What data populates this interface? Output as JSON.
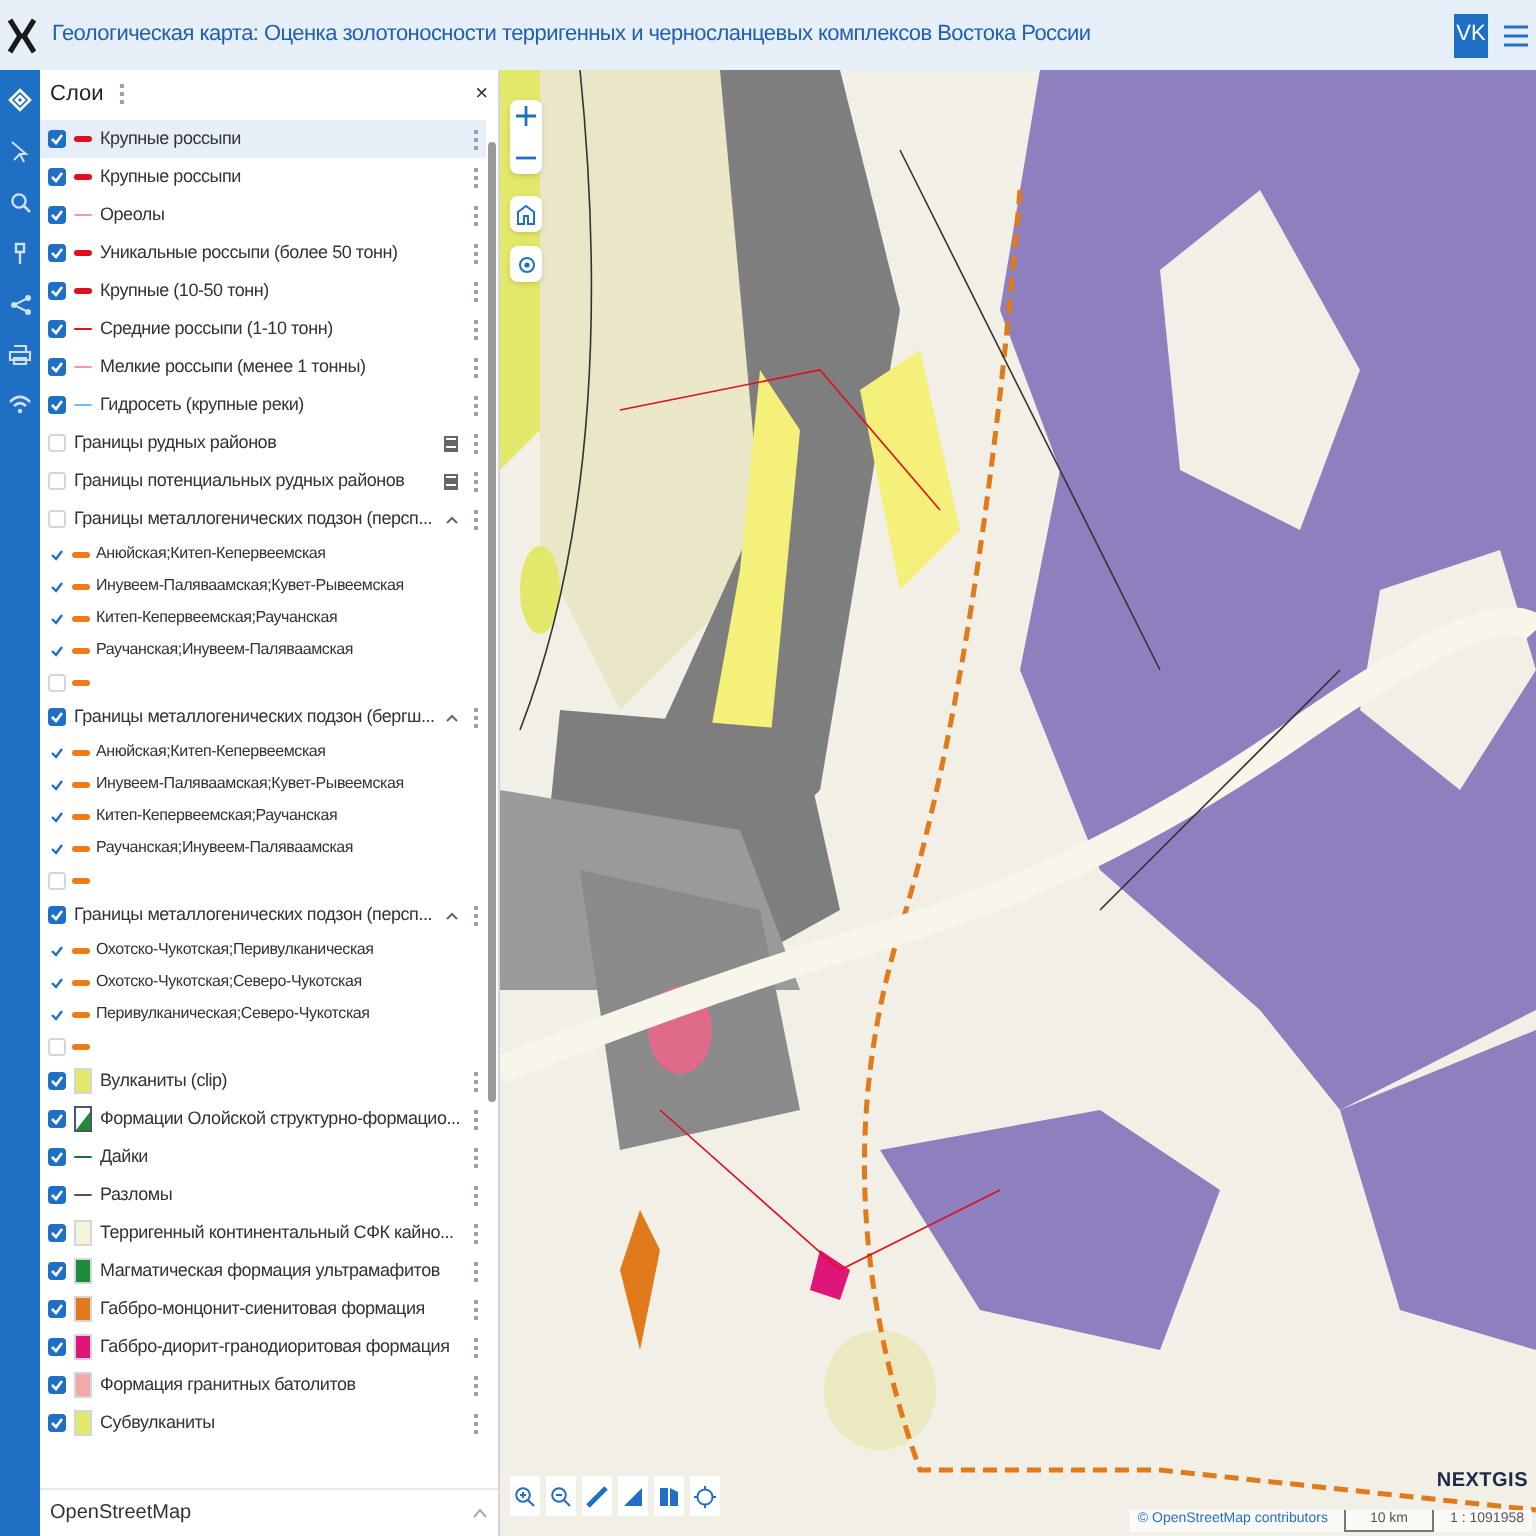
{
  "header": {
    "title": "Геологическая карта: Оценка золотоносности терригенных и черносланцевых комплексов Востока России",
    "user_badge": "VK"
  },
  "panel": {
    "title": "Слои",
    "close": "×",
    "footer": "OpenStreetMap"
  },
  "layers": [
    {
      "kind": "line",
      "label": "Крупные россыпи",
      "checked": true,
      "selected": true,
      "color": "#e0101a",
      "thick": true
    },
    {
      "kind": "line",
      "label": "Крупные россыпи",
      "checked": true,
      "selected": false,
      "color": "#e0101a",
      "thick": true
    },
    {
      "kind": "line",
      "label": "Ореолы",
      "checked": true,
      "selected": false,
      "color": "#f29aa8",
      "thick": false
    },
    {
      "kind": "line",
      "label": "Уникальные россыпи (более 50 тонн)",
      "checked": true,
      "selected": false,
      "color": "#e0101a",
      "thick": true
    },
    {
      "kind": "line",
      "label": "Крупные (10-50 тонн)",
      "checked": true,
      "selected": false,
      "color": "#e0101a",
      "thick": true
    },
    {
      "kind": "line",
      "label": "Средние россыпи (1-10 тонн)",
      "checked": true,
      "selected": false,
      "color": "#e0101a",
      "thick": false
    },
    {
      "kind": "line",
      "label": "Мелкие россыпи (менее 1 тонны)",
      "checked": true,
      "selected": false,
      "color": "#f29aa8",
      "thick": false
    },
    {
      "kind": "line",
      "label": "Гидросеть (крупные реки)",
      "checked": true,
      "selected": false,
      "color": "#7ab8f0",
      "thick": false
    },
    {
      "kind": "legend",
      "label": "Границы рудных районов",
      "checked": false,
      "selected": false
    },
    {
      "kind": "legend",
      "label": "Границы потенциальных рудных районов",
      "checked": false,
      "selected": false
    },
    {
      "kind": "group",
      "label": "Границы металлогенических подзон (персп...",
      "checked": false,
      "selected": false,
      "expanded": true,
      "children": [
        {
          "label": "Анюйская;Китеп-Кепервеемская",
          "checked": true
        },
        {
          "label": "Инувеем-Паляваамская;Кувет-Рывеемская",
          "checked": true
        },
        {
          "label": "Китеп-Кепервеемская;Раучанская",
          "checked": true
        },
        {
          "label": "Раучанская;Инувеем-Паляваамская",
          "checked": true
        },
        {
          "checked": false
        }
      ]
    },
    {
      "kind": "group",
      "label": "Границы металлогенических подзон (бергш...",
      "checked": true,
      "selected": false,
      "expanded": true,
      "children": [
        {
          "label": "Анюйская;Китеп-Кепервеемская",
          "checked": true
        },
        {
          "label": "Инувеем-Паляваамская;Кувет-Рывеемская",
          "checked": true
        },
        {
          "label": "Китеп-Кепервеемская;Раучанская",
          "checked": true
        },
        {
          "label": "Раучанская;Инувеем-Паляваамская",
          "checked": true
        },
        {
          "checked": false
        }
      ]
    },
    {
      "kind": "group",
      "label": "Границы металлогенических подзон (персп...",
      "checked": true,
      "selected": false,
      "expanded": true,
      "children": [
        {
          "label": "Охотско-Чукотская;Перивулканическая",
          "checked": true
        },
        {
          "label": "Охотско-Чукотская;Северо-Чукотская",
          "checked": true
        },
        {
          "label": "Перивулканическая;Северо-Чукотская",
          "checked": true
        },
        {
          "checked": false
        }
      ]
    },
    {
      "kind": "swatch",
      "label": "Вулканиты (clip)",
      "checked": true,
      "selected": false,
      "color": "#e2e86a"
    },
    {
      "kind": "corner",
      "label": "Формации Олойской структурно-формацио...",
      "checked": true,
      "selected": false,
      "color": "#1f8a3a"
    },
    {
      "kind": "line",
      "label": "Дайки",
      "checked": true,
      "selected": false,
      "color": "#1f6b3a",
      "thick": false
    },
    {
      "kind": "line",
      "label": "Разломы",
      "checked": true,
      "selected": false,
      "color": "#555555",
      "thick": false
    },
    {
      "kind": "swatch",
      "label": "Терригенный континентальный СФК кайно...",
      "checked": true,
      "selected": false,
      "color": "#f6f3dc"
    },
    {
      "kind": "swatch",
      "label": "Магматическая формация ультрамафитов",
      "checked": true,
      "selected": false,
      "color": "#1f8a3a"
    },
    {
      "kind": "swatch",
      "label": "Габбро-монцонит-сиенитовая формация",
      "checked": true,
      "selected": false,
      "color": "#e07a1a"
    },
    {
      "kind": "swatch",
      "label": "Габбро-диорит-гранодиоритовая формация",
      "checked": true,
      "selected": false,
      "color": "#e0157a"
    },
    {
      "kind": "swatch",
      "label": "Формация гранитных батолитов",
      "checked": true,
      "selected": false,
      "color": "#f4a9a9"
    },
    {
      "kind": "swatch",
      "label": "Субвулканиты",
      "checked": true,
      "selected": false,
      "color": "#e2e86a"
    }
  ],
  "map": {
    "logo": "NEXTGIS",
    "attribution": "© OpenStreetMap contributors",
    "scale_label": "10 km",
    "scale_ratio": "1 : 1091958"
  }
}
